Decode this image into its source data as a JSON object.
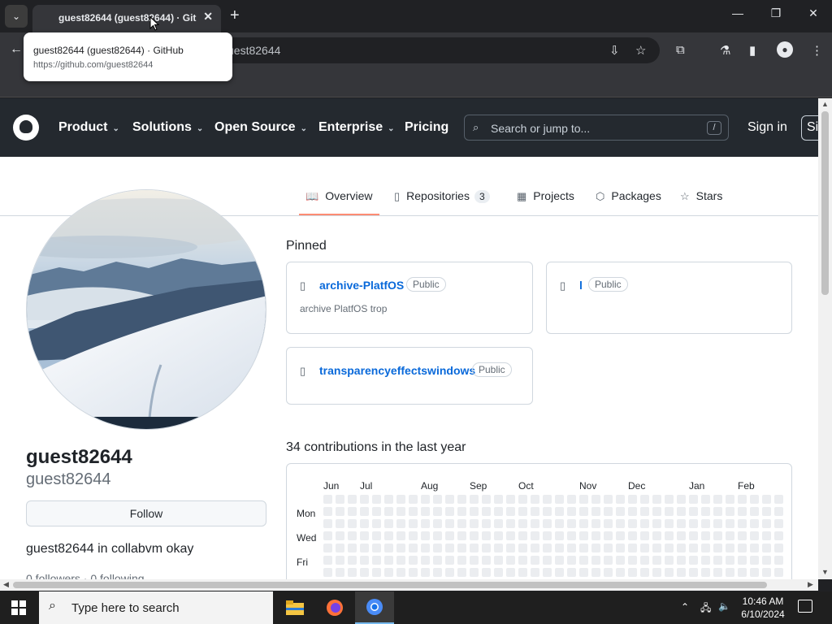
{
  "browser": {
    "tab_title": "guest82644 (guest82644) · GitHub",
    "tab_close": "✕",
    "new_tab": "+",
    "omnibox_text": "uest82644",
    "tooltip_title": "guest82644 (guest82644) · GitHub",
    "tooltip_url": "https://github.com/guest82644",
    "window_controls": [
      "—",
      "❐",
      "✕"
    ]
  },
  "github_header": {
    "nav": [
      "Product",
      "Solutions",
      "Open Source",
      "Enterprise",
      "Pricing"
    ],
    "search_placeholder": "Search or jump to...",
    "search_shortcut": "/",
    "sign_in": "Sign in",
    "sign_up_partial": "Si"
  },
  "profile_tabs": [
    {
      "label": "Overview",
      "icon": "book-icon",
      "glyph": "📖"
    },
    {
      "label": "Repositories",
      "icon": "repo-icon",
      "glyph": "▯",
      "count": "3"
    },
    {
      "label": "Projects",
      "icon": "table-icon",
      "glyph": "▦"
    },
    {
      "label": "Packages",
      "icon": "package-icon",
      "glyph": "⬡"
    },
    {
      "label": "Stars",
      "icon": "star-icon",
      "glyph": "☆"
    }
  ],
  "profile": {
    "display_name": "guest82644",
    "username": "guest82644",
    "follow_label": "Follow",
    "bio": "guest82644 in collabvm okay",
    "followers_partial": "0 followers · 0 following"
  },
  "pinned": {
    "title": "Pinned",
    "repos": [
      {
        "name": "archive-PlatfOS",
        "badge": "Public",
        "description": "archive PlatfOS trop"
      },
      {
        "name": "l",
        "badge": "Public",
        "description": ""
      },
      {
        "name": "transparencyeffectswindows",
        "badge": "Public",
        "description": ""
      }
    ]
  },
  "contributions": {
    "title": "34 contributions in the last year",
    "months": [
      "Jun",
      "Jul",
      "Aug",
      "Sep",
      "Oct",
      "Nov",
      "Dec",
      "Jan",
      "Feb"
    ],
    "days": [
      "Mon",
      "Wed",
      "Fri"
    ]
  },
  "taskbar": {
    "search_placeholder": "Type here to search",
    "time": "10:46 AM",
    "date": "6/10/2024"
  },
  "colors": {
    "gh_header_bg": "#24292f",
    "link_blue": "#0969da",
    "tab_underline": "#fd8c73"
  }
}
